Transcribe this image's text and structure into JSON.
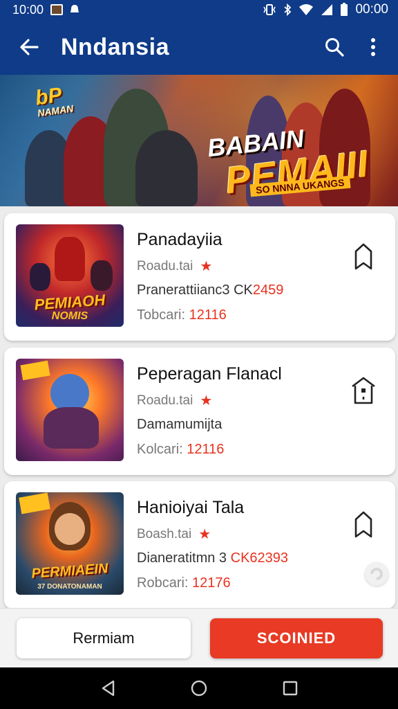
{
  "status_bar": {
    "time_left": "10:00",
    "time_right": "00:00",
    "icons": [
      "image-icon",
      "notification-icon",
      "vibrate-icon",
      "bluetooth-icon",
      "wifi-icon",
      "signal-icon",
      "battery-icon"
    ]
  },
  "app_bar": {
    "title": "Nndansia",
    "icons": [
      "back-arrow-icon",
      "search-icon",
      "more-vert-icon"
    ]
  },
  "banner": {
    "logo_text": "bP",
    "logo_sub": "NAMAN",
    "kicker": "BABAIN",
    "headline": "PEMAIII",
    "tagline": "SO NNNA UKANGS"
  },
  "cards": [
    {
      "title": "Panadayiia",
      "rating_label": "Roadu.tai",
      "desc_prefix": "Pranerattiianc3 CK",
      "desc_highlight": "2459",
      "meta_prefix": "Tobcari:",
      "meta_highlight": "12116",
      "thumb_text": "PEMIAOH",
      "thumb_sub": "NOMIS",
      "icon": "bookmark-icon"
    },
    {
      "title": "Peperagan Flanacl",
      "rating_label": "Roadu.tai",
      "desc_prefix": "Damamumijta",
      "desc_highlight": "",
      "meta_prefix": "Kolcari:",
      "meta_highlight": "12116",
      "thumb_text": "",
      "thumb_sub": "",
      "icon": "home-bookmark-icon"
    },
    {
      "title": "Hanioiyai Tala",
      "rating_label": "Boash.tai",
      "desc_prefix": "Dianeratitmn 3 ",
      "desc_highlight": "CK62393",
      "meta_prefix": "Robcari:",
      "meta_highlight": "12176",
      "thumb_text": "PERMIAEIN",
      "thumb_sub": "37 DONATONAMAN",
      "icon": "bookmark-icon"
    }
  ],
  "actions": {
    "secondary_label": "Rermiam",
    "primary_label": "SCOINIED"
  },
  "colors": {
    "app_bar": "#0f3b88",
    "accent_red": "#e83a24",
    "star": "#e8321f"
  }
}
